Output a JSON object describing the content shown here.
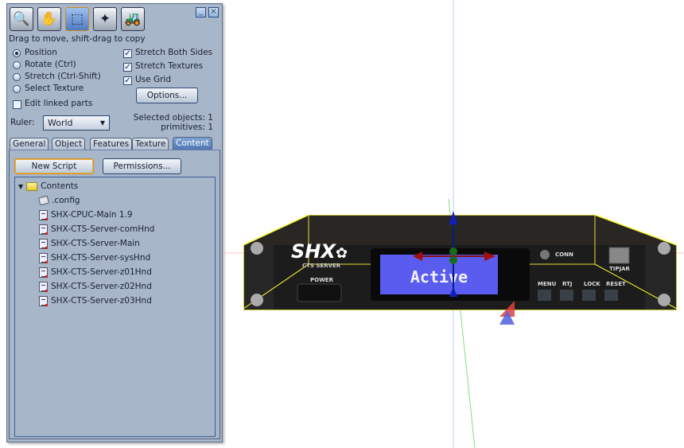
{
  "toolbar": {
    "tools": [
      {
        "name": "zoom",
        "icon": "magnifier-icon",
        "glyph": "🔍"
      },
      {
        "name": "grab",
        "icon": "hand-icon",
        "glyph": "✋"
      },
      {
        "name": "edit",
        "icon": "cube-cursor-icon",
        "glyph": "⬚",
        "active": true
      },
      {
        "name": "create",
        "icon": "magic-wand-icon",
        "glyph": "✦"
      },
      {
        "name": "land",
        "icon": "bulldozer-icon",
        "glyph": "🚜"
      }
    ],
    "minimize": "_",
    "close": "×"
  },
  "hint": "Drag to move, shift-drag to copy",
  "modes": [
    {
      "label": "Position",
      "selected": true
    },
    {
      "label": "Rotate (Ctrl)",
      "selected": false
    },
    {
      "label": "Stretch (Ctrl-Shift)",
      "selected": false
    },
    {
      "label": "Select Texture",
      "selected": false
    }
  ],
  "edit_linked": {
    "label": "Edit linked parts",
    "checked": false
  },
  "options": [
    {
      "label": "Stretch Both Sides",
      "checked": true
    },
    {
      "label": "Stretch Textures",
      "checked": true
    },
    {
      "label": "Use Grid",
      "checked": true
    }
  ],
  "options_button": "Options...",
  "ruler": {
    "label": "Ruler:",
    "value": "World"
  },
  "selection": {
    "objects": "Selected objects: 1",
    "primitives": "primitives: 1"
  },
  "tabs": [
    "General",
    "Object",
    "Features",
    "Texture",
    "Content"
  ],
  "active_tab": "Content",
  "content": {
    "new_script": "New Script",
    "permissions": "Permissions...",
    "folder": "Contents",
    "items": [
      ".config",
      "SHX-CPUC-Main 1.9",
      "SHX-CTS-Server-comHnd",
      "SHX-CTS-Server-Main",
      "SHX-CTS-Server-sysHnd",
      "SHX-CTS-Server-z01Hnd",
      "SHX-CTS-Server-z02Hnd",
      "SHX-CTS-Server-z03Hnd"
    ]
  },
  "device": {
    "brand": "SHX",
    "subtitle": "CTS SERVER",
    "power": "POWER",
    "display": "Active",
    "conn": "CONN",
    "tipjar": "TIPJAR",
    "buttons": [
      "MENU",
      "RTJ",
      "LOCK",
      "RESET"
    ],
    "lcd_color": "#5a5cf0",
    "highlight_color": "#ffff33"
  }
}
